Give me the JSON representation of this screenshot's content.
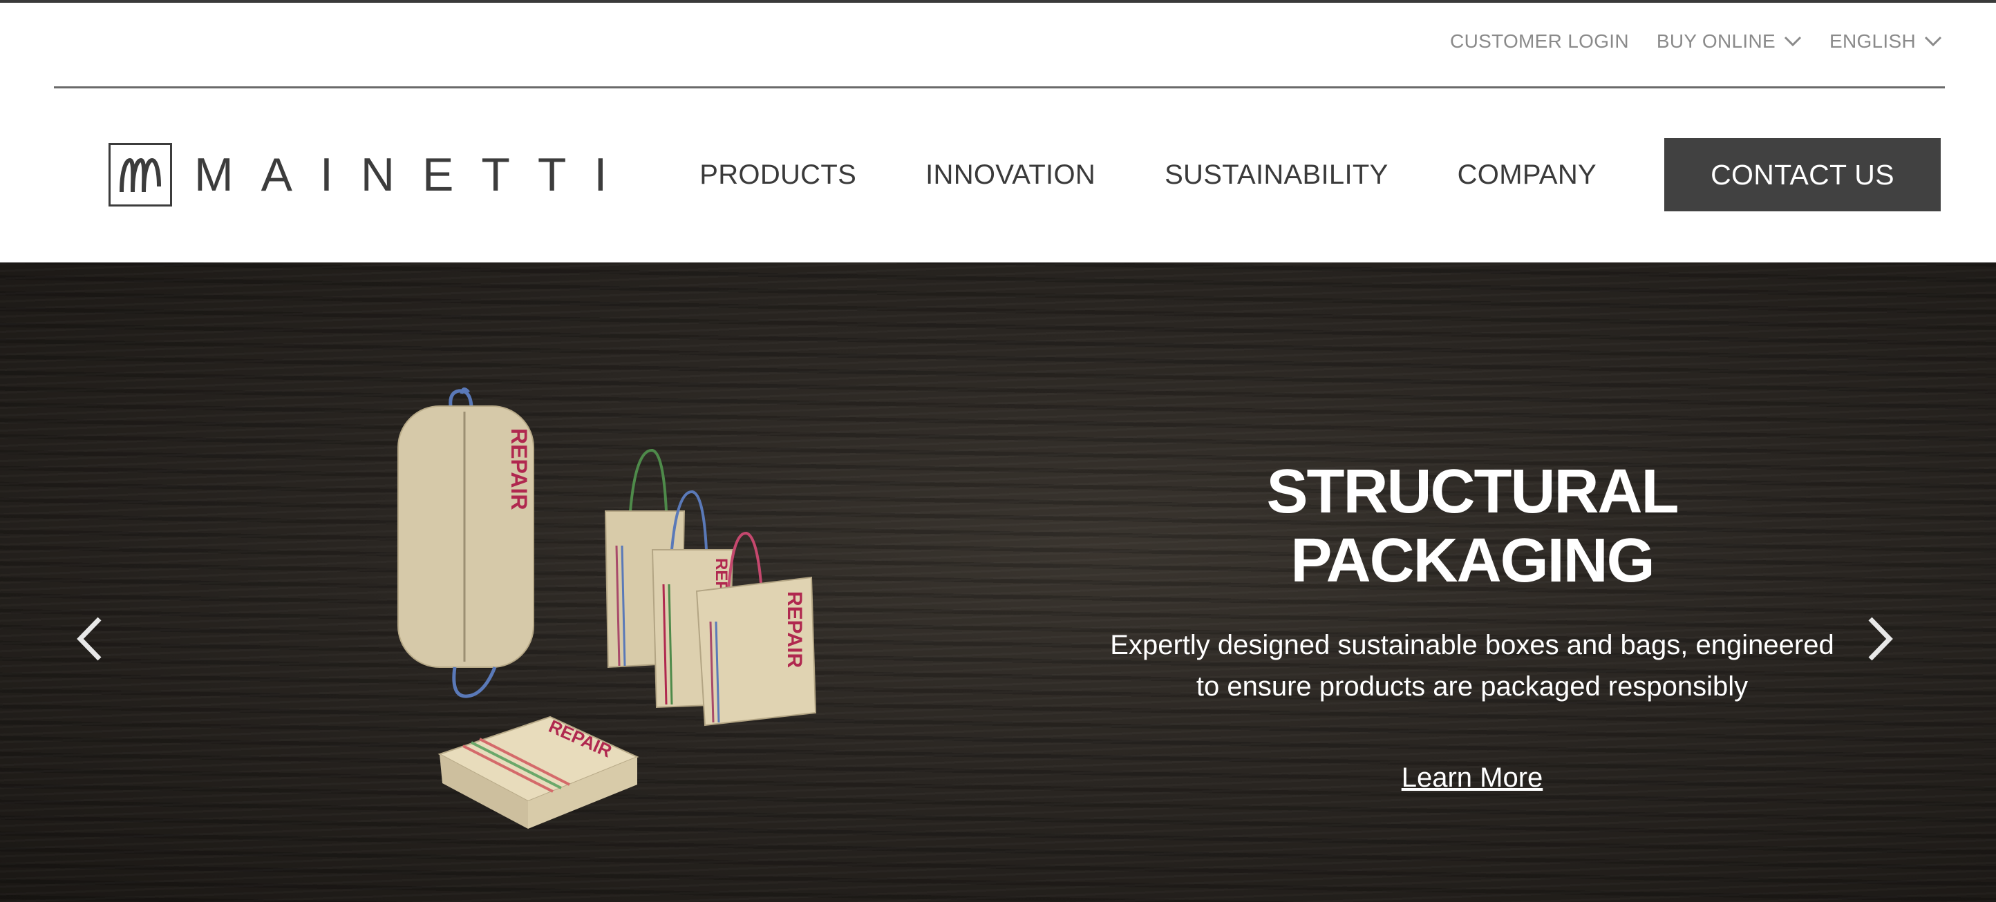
{
  "utility": {
    "customer_login": "CUSTOMER LOGIN",
    "buy_online": "BUY ONLINE",
    "language": "ENGLISH"
  },
  "brand": {
    "name": "MAINETTI"
  },
  "nav": {
    "items": [
      "PRODUCTS",
      "INNOVATION",
      "SUSTAINABILITY",
      "COMPANY"
    ],
    "contact": "CONTACT US"
  },
  "hero": {
    "title_line1": "STRUCTURAL",
    "title_line2": "PACKAGING",
    "desc_line1": "Expertly designed sustainable boxes and bags, engineered",
    "desc_line2": "to ensure products are packaged responsibly",
    "cta": "Learn More",
    "product_print": "REPAIR",
    "prev_icon": "chevron-left-icon",
    "next_icon": "chevron-right-icon"
  },
  "colors": {
    "text_dark": "#3a3a3a",
    "utility_text": "#8a8a8a",
    "contact_bg": "#414141",
    "hero_bg": "#2a2622",
    "print_red": "#b0284f",
    "kraft": "#d9ccae"
  }
}
